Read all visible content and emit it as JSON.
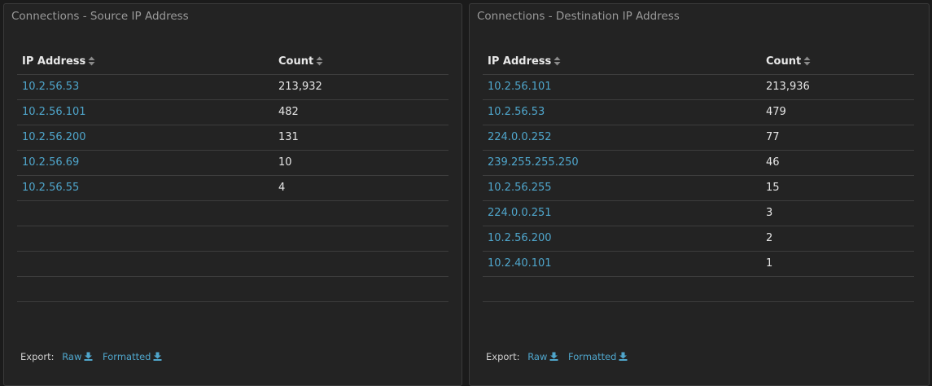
{
  "panels": {
    "source": {
      "title": "Connections - Source IP Address",
      "columns": {
        "ip": "IP Address",
        "count": "Count"
      },
      "rows": [
        {
          "ip": "10.2.56.53",
          "count": "213,932"
        },
        {
          "ip": "10.2.56.101",
          "count": "482"
        },
        {
          "ip": "10.2.56.200",
          "count": "131"
        },
        {
          "ip": "10.2.56.69",
          "count": "10"
        },
        {
          "ip": "10.2.56.55",
          "count": "4"
        },
        {
          "ip": "",
          "count": ""
        },
        {
          "ip": "",
          "count": ""
        },
        {
          "ip": "",
          "count": ""
        },
        {
          "ip": "",
          "count": ""
        }
      ],
      "export": {
        "label": "Export:",
        "raw": "Raw",
        "formatted": "Formatted"
      }
    },
    "dest": {
      "title": "Connections - Destination IP Address",
      "columns": {
        "ip": "IP Address",
        "count": "Count"
      },
      "rows": [
        {
          "ip": "10.2.56.101",
          "count": "213,936"
        },
        {
          "ip": "10.2.56.53",
          "count": "479"
        },
        {
          "ip": "224.0.0.252",
          "count": "77"
        },
        {
          "ip": "239.255.255.250",
          "count": "46"
        },
        {
          "ip": "10.2.56.255",
          "count": "15"
        },
        {
          "ip": "224.0.0.251",
          "count": "3"
        },
        {
          "ip": "10.2.56.200",
          "count": "2"
        },
        {
          "ip": "10.2.40.101",
          "count": "1"
        },
        {
          "ip": "",
          "count": ""
        }
      ],
      "export": {
        "label": "Export:",
        "raw": "Raw",
        "formatted": "Formatted"
      }
    }
  },
  "colors": {
    "background": "#1b1b1b",
    "panel": "#232323",
    "link": "#4fa6cc",
    "text": "#e6e6e6",
    "muted": "#9a9a9a"
  },
  "icons": {
    "sort": "sort-icon",
    "download": "download-icon"
  }
}
